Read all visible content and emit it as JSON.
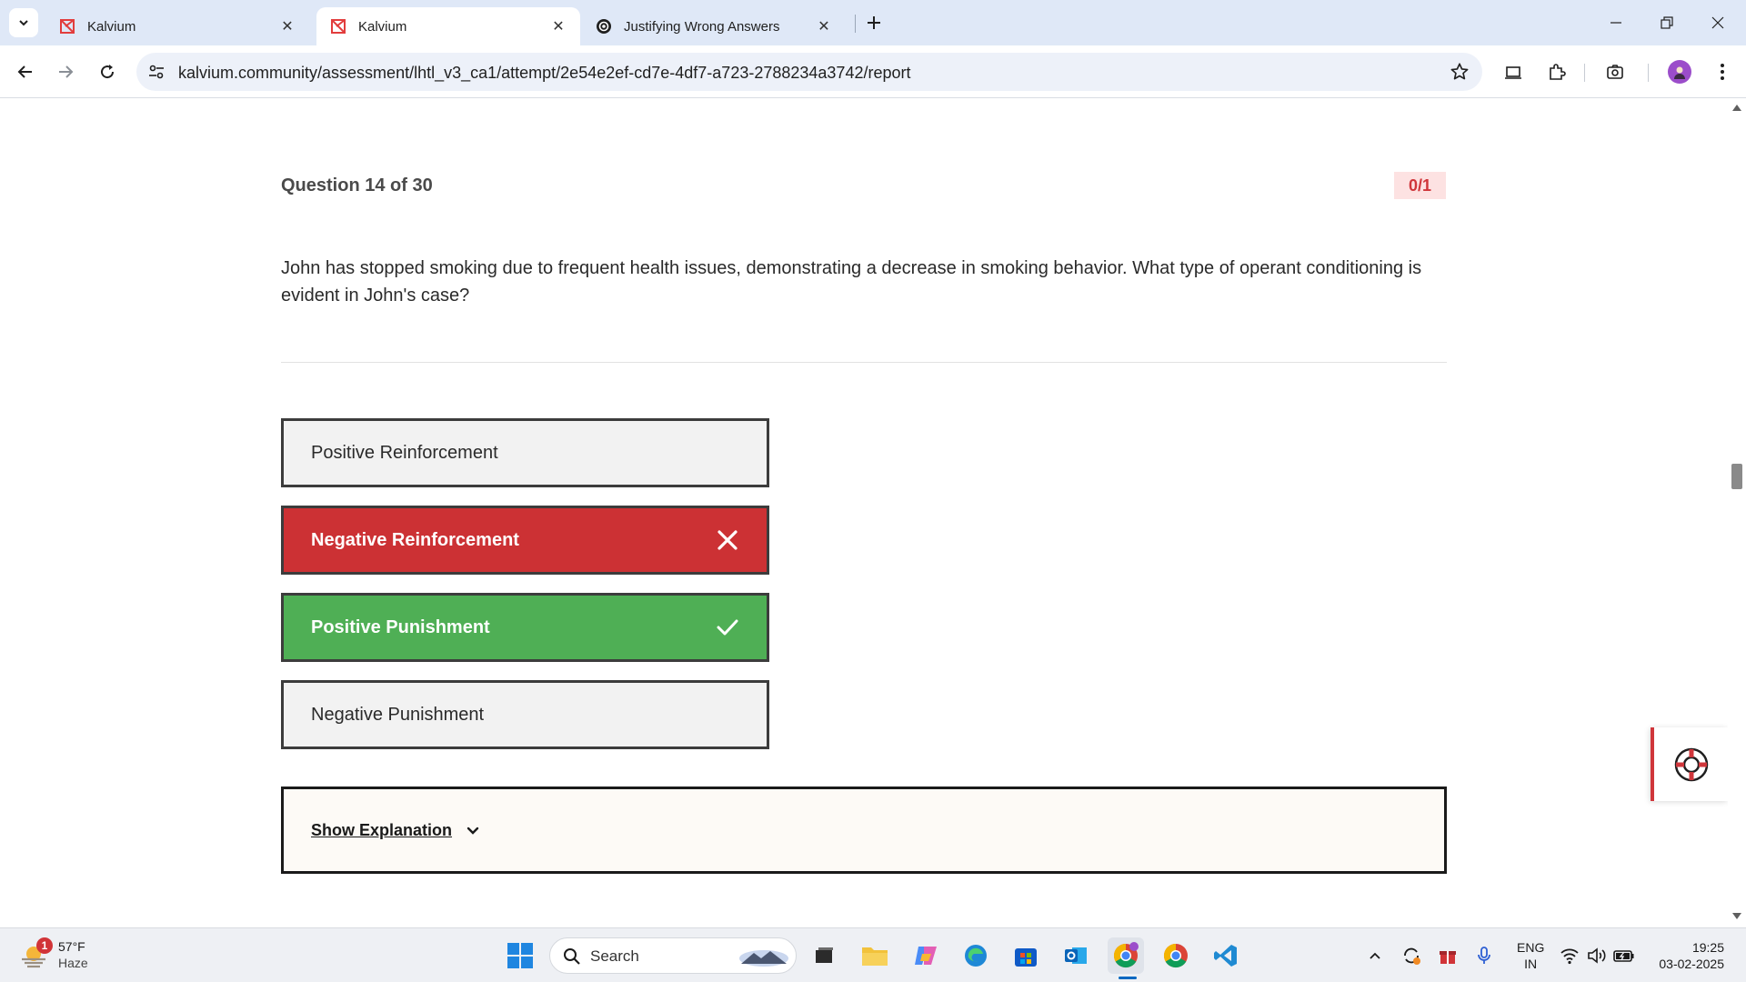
{
  "browser": {
    "tabs": [
      {
        "title": "Kalvium",
        "active": false
      },
      {
        "title": "Kalvium",
        "active": true
      },
      {
        "title": "Justifying Wrong Answers",
        "active": false
      }
    ],
    "url": "kalvium.community/assessment/lhtl_v3_ca1/attempt/2e54e2ef-cd7e-4df7-a723-2788234a3742/report"
  },
  "question": {
    "header": "Question 14 of 30",
    "score": "0/1",
    "text": "John has stopped smoking due to frequent health issues, demonstrating a decrease in smoking behavior. What type of operant conditioning is evident in John's case?",
    "options": [
      {
        "label": "Positive Reinforcement",
        "state": "neutral"
      },
      {
        "label": "Negative Reinforcement",
        "state": "wrong"
      },
      {
        "label": "Positive Punishment",
        "state": "correct"
      },
      {
        "label": "Negative Punishment",
        "state": "neutral"
      }
    ],
    "show_explanation": "Show Explanation"
  },
  "taskbar": {
    "weather": {
      "badge": "1",
      "temp": "57°F",
      "condition": "Haze"
    },
    "search_placeholder": "Search",
    "lang_line1": "ENG",
    "lang_line2": "IN",
    "time": "19:25",
    "date": "03-02-2025"
  },
  "colors": {
    "wrong": "#cc3134",
    "correct": "#4faf55",
    "score_text": "#d0363b",
    "score_bg": "#fde2e2"
  }
}
